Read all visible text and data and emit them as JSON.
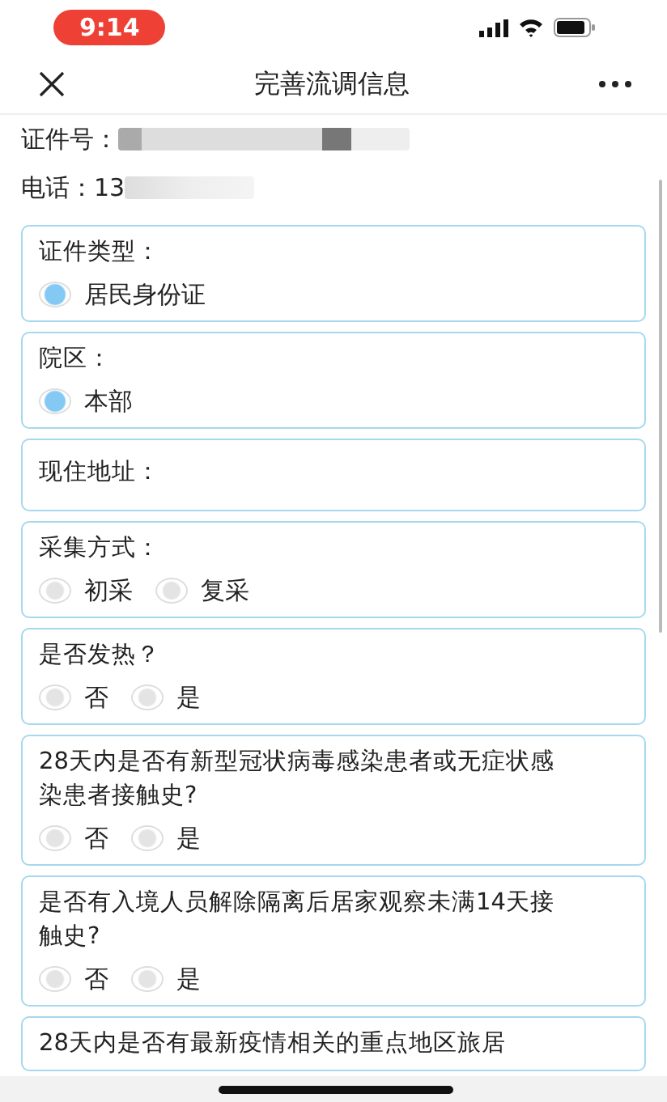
{
  "status_bar": {
    "time": "9:14"
  },
  "nav": {
    "title": "完善流调信息"
  },
  "info": [
    {
      "label": "证件号：",
      "redacted": true
    },
    {
      "label": "电话：",
      "value": "13",
      "redacted": true
    }
  ],
  "questions": [
    {
      "kind": "choice",
      "label": "证件类型：",
      "options": [
        {
          "label": "居民身份证",
          "selected": true
        }
      ]
    },
    {
      "kind": "choice",
      "label": "院区：",
      "options": [
        {
          "label": "本部",
          "selected": true
        }
      ]
    },
    {
      "kind": "text",
      "label": "现住地址："
    },
    {
      "kind": "choice",
      "label": "采集方式：",
      "options": [
        {
          "label": "初采",
          "selected": false
        },
        {
          "label": "复采",
          "selected": false
        }
      ]
    },
    {
      "kind": "choice",
      "label": "是否发热？",
      "options": [
        {
          "label": "否",
          "selected": false
        },
        {
          "label": "是",
          "selected": false
        }
      ]
    },
    {
      "kind": "choice",
      "label": "28天内是否有新型冠状病毒感染患者或无症状感染患者接触史?",
      "options": [
        {
          "label": "否",
          "selected": false
        },
        {
          "label": "是",
          "selected": false
        }
      ]
    },
    {
      "kind": "choice",
      "label": "是否有入境人员解除隔离后居家观察未满14天接触史?",
      "options": [
        {
          "label": "否",
          "selected": false
        },
        {
          "label": "是",
          "selected": false
        }
      ]
    },
    {
      "kind": "choice",
      "label": "28天内是否有最新疫情相关的重点地区旅居"
    }
  ]
}
